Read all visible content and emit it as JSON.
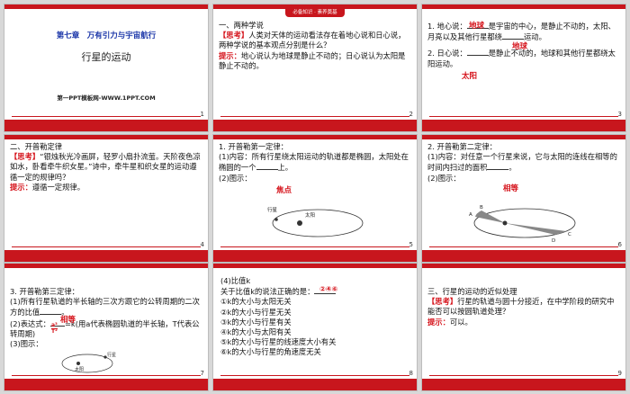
{
  "slides": [
    {
      "num": "1",
      "chapter": "第七章　万有引力与宇宙航行",
      "title": "行星的运动",
      "footer": "第一PPT模板网-WWW.1PPT.COM"
    },
    {
      "num": "2",
      "badge": "必备知识 · 素养奠基",
      "heading": "一、两种学说",
      "think_tag": "【思考】",
      "think_text": "人类对天体的运动看法存在着地心说和日心说，两种学说的基本观点分别是什么？",
      "hint_tag": "提示：",
      "hint_text": "地心说认为地球是静止不动的；日心说认为太阳是静止不动的。"
    },
    {
      "num": "3",
      "l1a": "1. 地心说：",
      "l1b": "是宇宙的中心，是静止不动的，太阳、月亮以及其他行星都绕",
      "l1c": "运动。",
      "hw1": "地球",
      "hw2": "地球",
      "l2a": "2. 日心说：",
      "l2b": "是静止不动的，地球和其他行星都绕太阳运动。",
      "hw3": "太阳"
    },
    {
      "num": "4",
      "heading": "二、开普勒定律",
      "think_tag": "【思考】",
      "think_text": "“银烛秋光冷画屏，轻罗小扇扑流萤。天阶夜色凉如水，卧看牵牛织女星。”诗中，牵牛星和织女星的运动遵循一定的规律吗？",
      "hint_tag": "提示：",
      "hint_text": "遵循一定规律。"
    },
    {
      "num": "5",
      "l1": "1. 开普勒第一定律：",
      "l2a": "(1)内容：所有行星绕太阳运动的轨道都是椭圆，太阳处在椭圆的一个",
      "l2b": "上。",
      "l3": "(2)图示：",
      "hw": "焦点",
      "fig_planet": "行星",
      "fig_sun": "太阳"
    },
    {
      "num": "6",
      "l1": "2. 开普勒第二定律：",
      "l2a": "(1)内容：对任意一个行星来说，它与太阳的连线在相等的时间内扫过的面积",
      "l2b": "。",
      "l3": "(2)图示：",
      "hw": "相等",
      "fig_a": "A",
      "fig_b": "B",
      "fig_c": "C",
      "fig_d": "D"
    },
    {
      "num": "7",
      "l1": "3. 开普勒第三定律：",
      "l2a": "(1)所有行星轨道的半长轴的三次方跟它的公转周期的二次方的比值",
      "l2b": "。",
      "l3a": "(2)表达式：",
      "l3b": "=k(用a代表椭圆轨道的半长轴，T代表公转周期)",
      "l4": "(3)图示：",
      "hw": "相等",
      "frac_top": "a³",
      "frac_bot": "T²",
      "fig_planet": "行星",
      "fig_sun": "太阳"
    },
    {
      "num": "8",
      "l0": "(4)比值k",
      "l1a": "关于比值k的说法正确的是：",
      "hw": "②④⑥",
      "opts": [
        "①k的大小与太阳无关",
        "②k的大小与行星无关",
        "③k的大小与行星有关",
        "④k的大小与太阳有关",
        "⑤k的大小与行星的线速度大小有关",
        "⑥k的大小与行星的角速度无关"
      ]
    },
    {
      "num": "9",
      "heading": "三、行星的运动的近似处理",
      "think_tag": "【思考】",
      "think_text": "行星的轨道与圆十分接近，在中学阶段的研究中能否可以按圆轨道处理？",
      "hint_tag": "提示：",
      "hint_text": "可以。"
    }
  ],
  "colors": {
    "accent": "#c8161d",
    "title_blue": "#1a35a8",
    "text": "#111111"
  }
}
